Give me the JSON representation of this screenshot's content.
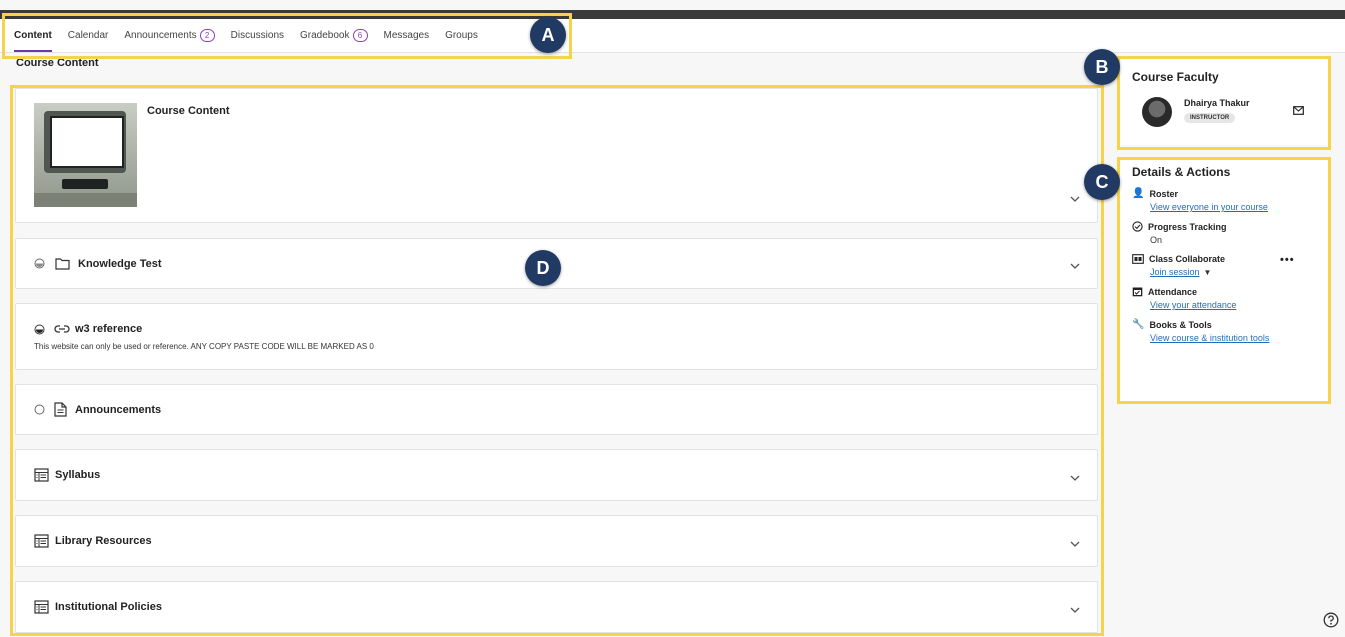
{
  "nav": {
    "tabs": [
      {
        "label": "Content",
        "active": true
      },
      {
        "label": "Calendar"
      },
      {
        "label": "Announcements",
        "badge": "2"
      },
      {
        "label": "Discussions"
      },
      {
        "label": "Gradebook",
        "badge": "6"
      },
      {
        "label": "Messages"
      },
      {
        "label": "Groups"
      }
    ]
  },
  "markers": {
    "a": "A",
    "b": "B",
    "c": "C",
    "d": "D"
  },
  "main": {
    "title": "Course Content",
    "items": [
      {
        "title": "Course Content"
      },
      {
        "title": "Knowledge Test",
        "icon": "folder-icon"
      },
      {
        "title": "w3 reference",
        "icon": "link-icon",
        "description": "This website can only be used or reference. ANY COPY PASTE CODE WILL BE MARKED AS 0"
      },
      {
        "title": "Announcements",
        "icon": "document-icon"
      },
      {
        "title": "Syllabus",
        "icon": "syllabus-icon"
      },
      {
        "title": "Library Resources",
        "icon": "syllabus-icon"
      },
      {
        "title": "Institutional Policies",
        "icon": "syllabus-icon"
      }
    ]
  },
  "faculty": {
    "title": "Course Faculty",
    "name": "Dhairya Thakur",
    "role": "INSTRUCTOR"
  },
  "details": {
    "title": "Details & Actions",
    "roster_label": "Roster",
    "roster_link": "View everyone in your course",
    "progress_label": "Progress Tracking",
    "progress_value": "On",
    "collab_label": "Class Collaborate",
    "collab_link": "Join session",
    "attendance_label": "Attendance",
    "attendance_link": "View your attendance",
    "books_label": "Books & Tools",
    "books_link": "View course & institution tools"
  },
  "colors": {
    "accent": "#6a3aa5",
    "highlight": "#f6d34a",
    "marker": "#213a63",
    "link": "#1f6fb8"
  }
}
